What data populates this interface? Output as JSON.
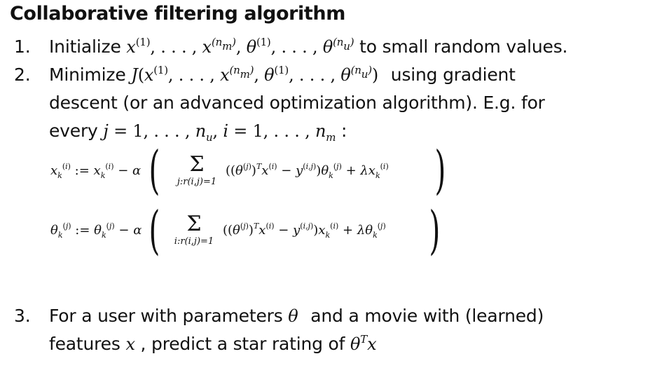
{
  "title": "Collaborative filtering algorithm",
  "step1": {
    "number": "1.",
    "text_before": "Initialize ",
    "math": "x(1),…,x(nm),θ(1),…,θ(nu)",
    "text_after": " to small random values."
  },
  "step2": {
    "number": "2.",
    "text_before": "Minimize ",
    "math": "J(x(1),…,x(nm),θ(1),…,θ(nu))",
    "text_after": " using gradient",
    "line2": "descent (or an advanced optimization algorithm). E.g. for",
    "line3_before": "every ",
    "line3_math": "j = 1,…,nu, i = 1,…,nm",
    "line3_after": " :"
  },
  "update_x": {
    "lhs": "x_k^(i) := x_k^(i) − α",
    "sum_under": "j:r(i,j)=1",
    "summand": "((θ(j))T x(i) − y(i,j)) θk(j) + λ xk(i)"
  },
  "update_theta": {
    "lhs": "θ_k^(j) := θ_k^(j) − α",
    "sum_under": "i:r(i,j)=1",
    "summand": "((θ(j))T x(i) − y(i,j)) xk(i) + λ θk(j)"
  },
  "step3": {
    "number": "3.",
    "text_a": "For a user with parameters ",
    "math_a": "θ",
    "text_b": " and a movie with (learned)",
    "line2_a": "features ",
    "math_b": "x",
    "line2_b": " , predict a star rating of ",
    "math_c": "θT x"
  }
}
